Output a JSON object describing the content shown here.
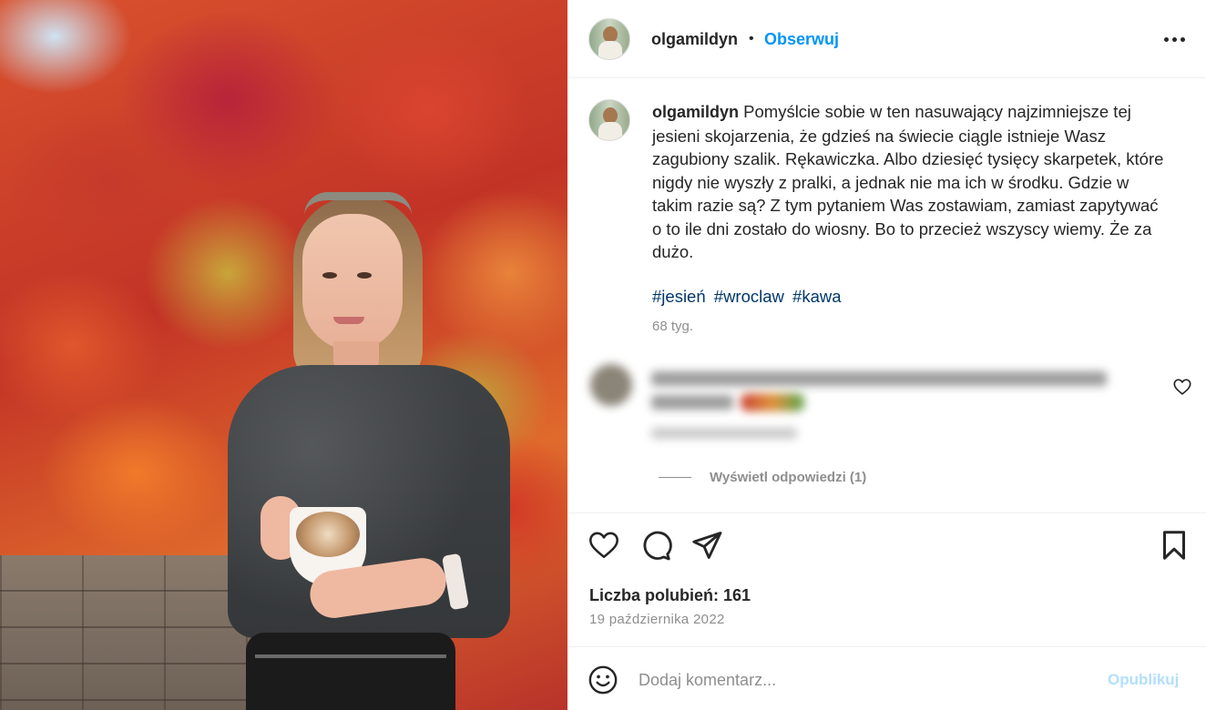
{
  "post": {
    "username": "olgamildyn",
    "separator": "•",
    "follow_label": "Obserwuj",
    "more_icon": "more-horizontal-icon"
  },
  "caption": {
    "username": "olgamildyn",
    "text": "Pomyślcie sobie w ten nasuwający najzimniejsze tej jesieni skojarzenia, że gdzieś na świecie ciągle istnieje Wasz zagubiony szalik. Rękawiczka. Albo dziesięć tysięcy skarpetek, które nigdy nie wyszły z pralki, a jednak nie ma ich w środku. Gdzie w takim razie są? Z tym pytaniem Was zostawiam, zamiast zapytywać o to ile dni zostało do wiosny. Bo to przecież wszyscy wiemy. Że za dużo.",
    "hashtags": [
      "#jesień",
      "#wroclaw",
      "#kawa"
    ],
    "time": "68 tyg."
  },
  "comments": {
    "view_replies_label": "Wyświetl odpowiedzi (1)"
  },
  "actions": {
    "like_icon": "heart-icon",
    "comment_icon": "comment-icon",
    "share_icon": "share-icon",
    "save_icon": "bookmark-icon"
  },
  "likes_text": "Liczba polubień: 161",
  "date": "19 października 2022",
  "comment_bar": {
    "placeholder": "Dodaj komentarz...",
    "publish_label": "Opublikuj"
  },
  "colors": {
    "link_blue": "#0095f6",
    "hashtag": "#00376b",
    "muted": "#8e8e8e",
    "publish_disabled": "#b2dffc"
  }
}
